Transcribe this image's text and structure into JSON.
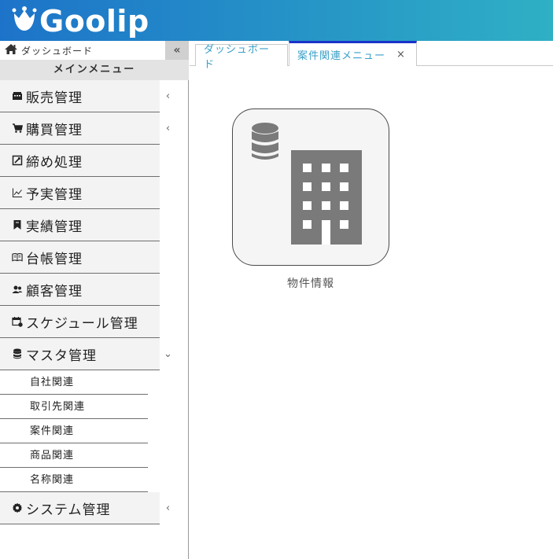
{
  "brand": {
    "name": "Goolip"
  },
  "sidebar": {
    "dashboard_label": "ダッシュボード",
    "collapse_glyph": "«",
    "main_menu_title": "メインメニュー",
    "items": [
      {
        "label": "販売管理",
        "icon": "register-icon",
        "chevron": "‹"
      },
      {
        "label": "購買管理",
        "icon": "cart-icon",
        "chevron": "‹"
      },
      {
        "label": "締め処理",
        "icon": "edit-box-icon",
        "chevron": ""
      },
      {
        "label": "予実管理",
        "icon": "line-chart-icon",
        "chevron": ""
      },
      {
        "label": "実績管理",
        "icon": "bookmark-icon",
        "chevron": ""
      },
      {
        "label": "台帳管理",
        "icon": "book-icon",
        "chevron": ""
      },
      {
        "label": "顧客管理",
        "icon": "users-icon",
        "chevron": ""
      },
      {
        "label": "スケジュール管理",
        "icon": "calendar-icon",
        "chevron": ""
      },
      {
        "label": "マスタ管理",
        "icon": "database-icon",
        "chevron": "⌄"
      }
    ],
    "master_sub_items": [
      "自社関連",
      "取引先関連",
      "案件関連",
      "商品関連",
      "名称関連"
    ],
    "system_item": {
      "label": "システム管理",
      "icon": "gear-icon",
      "chevron": "‹"
    }
  },
  "tabs": [
    {
      "label": "ダッシュボード",
      "active": false
    },
    {
      "label": "案件関連メニュー",
      "active": true,
      "close": "×"
    }
  ],
  "content": {
    "cards": [
      {
        "label": "物件情報",
        "icon": "database-building-icon"
      }
    ]
  },
  "colors": {
    "header_start": "#1d73c9",
    "header_end": "#2fb0c5",
    "tab_active_border": "#1a33c9",
    "tab_text": "#3aa0c8",
    "icon_gray": "#7a7a7a"
  }
}
